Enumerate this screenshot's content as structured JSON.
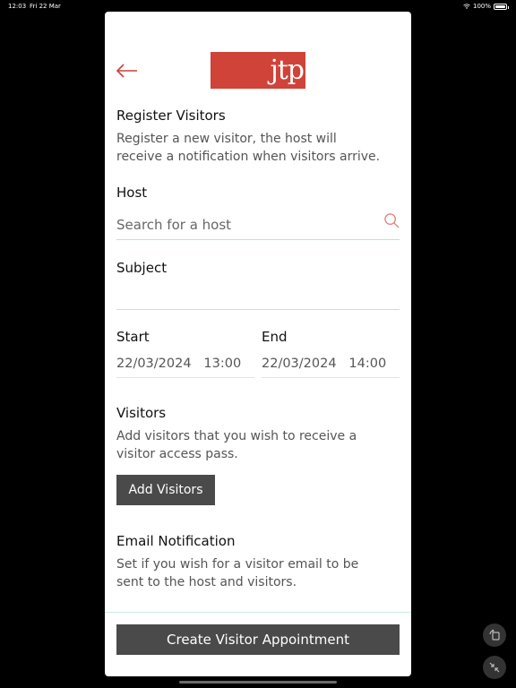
{
  "status_bar": {
    "time": "12:03",
    "date": "Fri 22 Mar",
    "battery": "100%",
    "icons": [
      "wifi-icon",
      "battery-icon"
    ]
  },
  "header": {
    "back_icon": "arrow-left-icon",
    "logo_text": "jtp"
  },
  "form": {
    "title": "Register Visitors",
    "intro": "Register a new visitor, the host will receive a notification when visitors arrive.",
    "host": {
      "label": "Host",
      "placeholder": "Search for a host",
      "icon": "search-icon"
    },
    "subject": {
      "label": "Subject",
      "value": ""
    },
    "start": {
      "label": "Start",
      "value": "22/03/2024   13:00"
    },
    "end": {
      "label": "End",
      "value": "22/03/2024   14:00"
    },
    "visitors": {
      "label": "Visitors",
      "description": "Add visitors that you wish to receive a visitor access pass.",
      "button_label": "Add Visitors"
    },
    "email_notification": {
      "label": "Email Notification",
      "description": "Set if you wish for a visitor email to be sent to the host and visitors."
    },
    "submit_label": "Create Visitor Appointment"
  },
  "colors": {
    "accent": "#cf4339",
    "button_bg": "#4a4a4a",
    "divider": "#bfe0e0"
  }
}
